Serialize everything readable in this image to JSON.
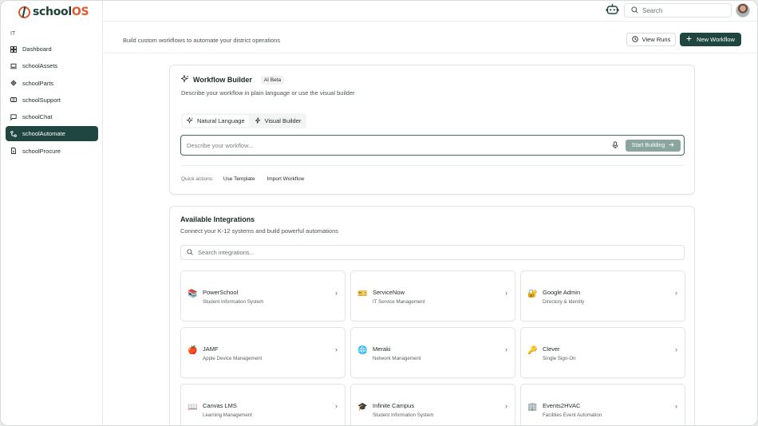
{
  "brand": {
    "name_prefix": "school",
    "name_suffix": "OS"
  },
  "sidebar": {
    "section": "IT",
    "items": [
      {
        "label": "Dashboard",
        "icon": "grid-icon"
      },
      {
        "label": "schoolAssets",
        "icon": "laptop-icon"
      },
      {
        "label": "schoolParts",
        "icon": "parts-icon"
      },
      {
        "label": "schoolSupport",
        "icon": "ticket-icon"
      },
      {
        "label": "schoolChat",
        "icon": "chat-icon"
      },
      {
        "label": "schoolAutomate",
        "icon": "workflow-icon",
        "active": true
      },
      {
        "label": "schoolProcure",
        "icon": "document-icon"
      }
    ]
  },
  "topbar": {
    "search_placeholder": "Search"
  },
  "header": {
    "subtitle": "Build custom workflows to automate your district operations",
    "view_runs": "View Runs",
    "new_workflow": "New Workflow"
  },
  "workflow_builder": {
    "title": "Workflow Builder",
    "badge": "AI Beta",
    "description": "Describe your workflow in plain language or use the visual builder",
    "tabs": [
      {
        "label": "Natural Language",
        "active": true
      },
      {
        "label": "Visual Builder",
        "active": false
      }
    ],
    "input_placeholder": "Describe your workflow...",
    "start_button": "Start Building",
    "quick_actions_label": "Quick actions:",
    "quick_actions": [
      "Use Template",
      "Import Workflow"
    ]
  },
  "integrations": {
    "title": "Available Integrations",
    "description": "Connect your K-12 systems and build powerful automations",
    "search_placeholder": "Search integrations...",
    "items": [
      {
        "name": "PowerSchool",
        "subtitle": "Student Information System",
        "emoji": "📚"
      },
      {
        "name": "ServiceNow",
        "subtitle": "IT Service Management",
        "emoji": "🎫"
      },
      {
        "name": "Google Admin",
        "subtitle": "Directory & Identity",
        "emoji": "🔐"
      },
      {
        "name": "JAMF",
        "subtitle": "Apple Device Management",
        "emoji": "🍎"
      },
      {
        "name": "Meraki",
        "subtitle": "Network Management",
        "emoji": "🌐"
      },
      {
        "name": "Clever",
        "subtitle": "Single Sign-On",
        "emoji": "🔑"
      },
      {
        "name": "Canvas LMS",
        "subtitle": "Learning Management",
        "emoji": "📖"
      },
      {
        "name": "Infinite Campus",
        "subtitle": "Student Information System",
        "emoji": "🎓"
      },
      {
        "name": "Events2HVAC",
        "subtitle": "Facilities Event Automation",
        "emoji": "🏢"
      }
    ]
  },
  "colors": {
    "primary": "#1f4640",
    "accent": "#e2572b",
    "start_button": "#8aa59e"
  }
}
